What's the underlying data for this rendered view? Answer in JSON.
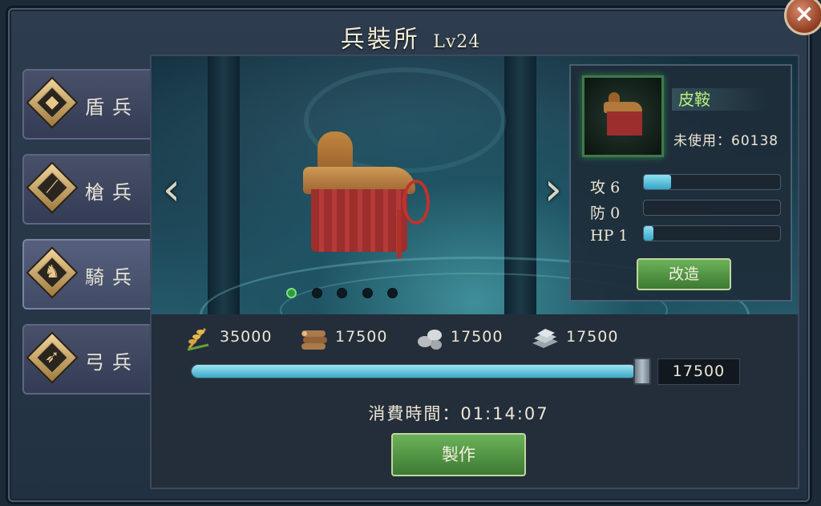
{
  "header": {
    "title": "兵裝所",
    "level": "Lv24"
  },
  "close_label": "×",
  "tabs": [
    {
      "label": "盾兵",
      "icon": "shield-icon",
      "glyph": "◆",
      "active": false
    },
    {
      "label": "槍兵",
      "icon": "spear-icon",
      "glyph": "⟋",
      "active": false
    },
    {
      "label": "騎兵",
      "icon": "horse-icon",
      "glyph": "♞",
      "active": true
    },
    {
      "label": "弓兵",
      "icon": "bow-icon",
      "glyph": "➶",
      "active": false
    }
  ],
  "carousel": {
    "prev_icon": "chevron-left-icon",
    "next_icon": "chevron-right-icon",
    "prev": "‹",
    "next": "›",
    "page_count": 5,
    "active_page": 1
  },
  "item": {
    "name": "皮鞍",
    "unused_label": "未使用：60138",
    "stats": [
      {
        "label": "攻",
        "value": "6",
        "fill": 0.2
      },
      {
        "label": "防",
        "value": "0",
        "fill": 0.0
      },
      {
        "label": "HP",
        "value": "1",
        "fill": 0.07
      }
    ],
    "upgrade_label": "改造"
  },
  "resources": [
    {
      "icon": "wheat-icon",
      "value": "35000"
    },
    {
      "icon": "wood-icon",
      "value": "17500"
    },
    {
      "icon": "stone-icon",
      "value": "17500"
    },
    {
      "icon": "iron-icon",
      "value": "17500"
    }
  ],
  "quantity": {
    "value": "17500",
    "fill": 0.98
  },
  "time_label": "消費時間：01:14:07",
  "craft_label": "製作",
  "colors": {
    "accent_green": "#4f9a40",
    "bar_blue": "#3aa8c8",
    "name_green": "#b8f07a"
  }
}
